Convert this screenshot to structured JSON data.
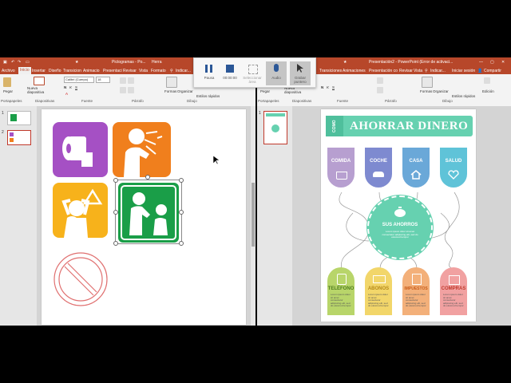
{
  "left_window": {
    "title": "Pictogramas - Po...",
    "title_extra": "Herra",
    "tabs": [
      "Archivo",
      "Inicio",
      "Insertar",
      "Diseño",
      "Transicion",
      "Animacio",
      "Presentaci",
      "Revisar",
      "Vista",
      "Formato",
      "Indicar..."
    ],
    "active_tab_index": 1,
    "ribbon": {
      "paste": "Pegar",
      "new_slide": "Nueva diapositiva",
      "font_name": "Calibri (Cuerpo)",
      "font_size": "18",
      "shapes": "Formas",
      "arrange": "Organizar",
      "quick_styles": "Estilos rápidos",
      "groups": [
        "Portapapeles",
        "Diapositivas",
        "Fuente",
        "Párrafo",
        "Dibujo"
      ]
    },
    "slide_numbers": [
      "1",
      "2"
    ]
  },
  "recorder": {
    "pause_label": "Pausa",
    "stop_label": "00:00:00",
    "select_area_label": "Seleccionar área",
    "audio_label": "Audio",
    "pointer_label": "Grabar puntero"
  },
  "right_window": {
    "title": "Presentación2 - PowerPoint (Error de activaci...",
    "tabs": [
      "Transiciones",
      "Animaciones",
      "Presentación co",
      "Revisar",
      "Vista",
      "Indicar...",
      "Iniciar sesión",
      "Compartir"
    ],
    "ribbon": {
      "paste": "Pegar",
      "new_slide": "Nueva diapositiva",
      "shapes": "Formas",
      "arrange": "Organizar",
      "quick_styles": "Estilos rápidos",
      "editing": "Edición",
      "groups": [
        "Portapapeles",
        "Diapositivas",
        "Fuente",
        "Párrafo",
        "Dibujo"
      ]
    },
    "slide_numbers": [
      "1"
    ]
  },
  "infographic": {
    "side_label": "COMO",
    "title": "AHORRAR DINERO",
    "center": "SUS AHORROS",
    "top_cards": [
      {
        "label": "COMIDA",
        "color": "#b79fd0"
      },
      {
        "label": "COCHE",
        "color": "#7e8ad0"
      },
      {
        "label": "CASA",
        "color": "#6aa8d8"
      },
      {
        "label": "SALUD",
        "color": "#5fc3d8"
      }
    ],
    "bottom_cards": [
      {
        "label": "TELÉFONO",
        "color": "#b8d56a",
        "text": "#4e7d1e"
      },
      {
        "label": "ABONOS",
        "color": "#f2d66a",
        "text": "#b5891a"
      },
      {
        "label": "IMPUESTOS",
        "color": "#f3b07a",
        "text": "#c85c1a"
      },
      {
        "label": "COMPRAS",
        "color": "#f1a1a1",
        "text": "#c0392b"
      }
    ],
    "lorem": "Lorem ipsum dolor sit amet consectetur adipiscing elit, sed do eiusmod tempor"
  },
  "colors": {
    "ppt_red": "#b7472a",
    "toilet_purple": "#a550c4",
    "cough_orange": "#f07f1d",
    "headache_yellow": "#f7b21b",
    "doctor_green": "#1a9e48",
    "prohibited_red": "#e07070",
    "infographic_teal": "#66d1b0"
  }
}
